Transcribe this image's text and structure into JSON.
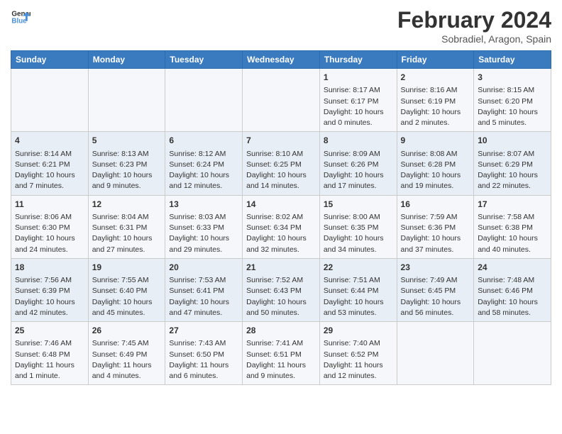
{
  "header": {
    "logo_line1": "General",
    "logo_line2": "Blue",
    "main_title": "February 2024",
    "subtitle": "Sobradiel, Aragon, Spain"
  },
  "days_of_week": [
    "Sunday",
    "Monday",
    "Tuesday",
    "Wednesday",
    "Thursday",
    "Friday",
    "Saturday"
  ],
  "rows": [
    [
      {
        "day": "",
        "lines": []
      },
      {
        "day": "",
        "lines": []
      },
      {
        "day": "",
        "lines": []
      },
      {
        "day": "",
        "lines": []
      },
      {
        "day": "1",
        "lines": [
          "Sunrise: 8:17 AM",
          "Sunset: 6:17 PM",
          "Daylight: 10 hours",
          "and 0 minutes."
        ]
      },
      {
        "day": "2",
        "lines": [
          "Sunrise: 8:16 AM",
          "Sunset: 6:19 PM",
          "Daylight: 10 hours",
          "and 2 minutes."
        ]
      },
      {
        "day": "3",
        "lines": [
          "Sunrise: 8:15 AM",
          "Sunset: 6:20 PM",
          "Daylight: 10 hours",
          "and 5 minutes."
        ]
      }
    ],
    [
      {
        "day": "4",
        "lines": [
          "Sunrise: 8:14 AM",
          "Sunset: 6:21 PM",
          "Daylight: 10 hours",
          "and 7 minutes."
        ]
      },
      {
        "day": "5",
        "lines": [
          "Sunrise: 8:13 AM",
          "Sunset: 6:23 PM",
          "Daylight: 10 hours",
          "and 9 minutes."
        ]
      },
      {
        "day": "6",
        "lines": [
          "Sunrise: 8:12 AM",
          "Sunset: 6:24 PM",
          "Daylight: 10 hours",
          "and 12 minutes."
        ]
      },
      {
        "day": "7",
        "lines": [
          "Sunrise: 8:10 AM",
          "Sunset: 6:25 PM",
          "Daylight: 10 hours",
          "and 14 minutes."
        ]
      },
      {
        "day": "8",
        "lines": [
          "Sunrise: 8:09 AM",
          "Sunset: 6:26 PM",
          "Daylight: 10 hours",
          "and 17 minutes."
        ]
      },
      {
        "day": "9",
        "lines": [
          "Sunrise: 8:08 AM",
          "Sunset: 6:28 PM",
          "Daylight: 10 hours",
          "and 19 minutes."
        ]
      },
      {
        "day": "10",
        "lines": [
          "Sunrise: 8:07 AM",
          "Sunset: 6:29 PM",
          "Daylight: 10 hours",
          "and 22 minutes."
        ]
      }
    ],
    [
      {
        "day": "11",
        "lines": [
          "Sunrise: 8:06 AM",
          "Sunset: 6:30 PM",
          "Daylight: 10 hours",
          "and 24 minutes."
        ]
      },
      {
        "day": "12",
        "lines": [
          "Sunrise: 8:04 AM",
          "Sunset: 6:31 PM",
          "Daylight: 10 hours",
          "and 27 minutes."
        ]
      },
      {
        "day": "13",
        "lines": [
          "Sunrise: 8:03 AM",
          "Sunset: 6:33 PM",
          "Daylight: 10 hours",
          "and 29 minutes."
        ]
      },
      {
        "day": "14",
        "lines": [
          "Sunrise: 8:02 AM",
          "Sunset: 6:34 PM",
          "Daylight: 10 hours",
          "and 32 minutes."
        ]
      },
      {
        "day": "15",
        "lines": [
          "Sunrise: 8:00 AM",
          "Sunset: 6:35 PM",
          "Daylight: 10 hours",
          "and 34 minutes."
        ]
      },
      {
        "day": "16",
        "lines": [
          "Sunrise: 7:59 AM",
          "Sunset: 6:36 PM",
          "Daylight: 10 hours",
          "and 37 minutes."
        ]
      },
      {
        "day": "17",
        "lines": [
          "Sunrise: 7:58 AM",
          "Sunset: 6:38 PM",
          "Daylight: 10 hours",
          "and 40 minutes."
        ]
      }
    ],
    [
      {
        "day": "18",
        "lines": [
          "Sunrise: 7:56 AM",
          "Sunset: 6:39 PM",
          "Daylight: 10 hours",
          "and 42 minutes."
        ]
      },
      {
        "day": "19",
        "lines": [
          "Sunrise: 7:55 AM",
          "Sunset: 6:40 PM",
          "Daylight: 10 hours",
          "and 45 minutes."
        ]
      },
      {
        "day": "20",
        "lines": [
          "Sunrise: 7:53 AM",
          "Sunset: 6:41 PM",
          "Daylight: 10 hours",
          "and 47 minutes."
        ]
      },
      {
        "day": "21",
        "lines": [
          "Sunrise: 7:52 AM",
          "Sunset: 6:43 PM",
          "Daylight: 10 hours",
          "and 50 minutes."
        ]
      },
      {
        "day": "22",
        "lines": [
          "Sunrise: 7:51 AM",
          "Sunset: 6:44 PM",
          "Daylight: 10 hours",
          "and 53 minutes."
        ]
      },
      {
        "day": "23",
        "lines": [
          "Sunrise: 7:49 AM",
          "Sunset: 6:45 PM",
          "Daylight: 10 hours",
          "and 56 minutes."
        ]
      },
      {
        "day": "24",
        "lines": [
          "Sunrise: 7:48 AM",
          "Sunset: 6:46 PM",
          "Daylight: 10 hours",
          "and 58 minutes."
        ]
      }
    ],
    [
      {
        "day": "25",
        "lines": [
          "Sunrise: 7:46 AM",
          "Sunset: 6:48 PM",
          "Daylight: 11 hours",
          "and 1 minute."
        ]
      },
      {
        "day": "26",
        "lines": [
          "Sunrise: 7:45 AM",
          "Sunset: 6:49 PM",
          "Daylight: 11 hours",
          "and 4 minutes."
        ]
      },
      {
        "day": "27",
        "lines": [
          "Sunrise: 7:43 AM",
          "Sunset: 6:50 PM",
          "Daylight: 11 hours",
          "and 6 minutes."
        ]
      },
      {
        "day": "28",
        "lines": [
          "Sunrise: 7:41 AM",
          "Sunset: 6:51 PM",
          "Daylight: 11 hours",
          "and 9 minutes."
        ]
      },
      {
        "day": "29",
        "lines": [
          "Sunrise: 7:40 AM",
          "Sunset: 6:52 PM",
          "Daylight: 11 hours",
          "and 12 minutes."
        ]
      },
      {
        "day": "",
        "lines": []
      },
      {
        "day": "",
        "lines": []
      }
    ]
  ]
}
